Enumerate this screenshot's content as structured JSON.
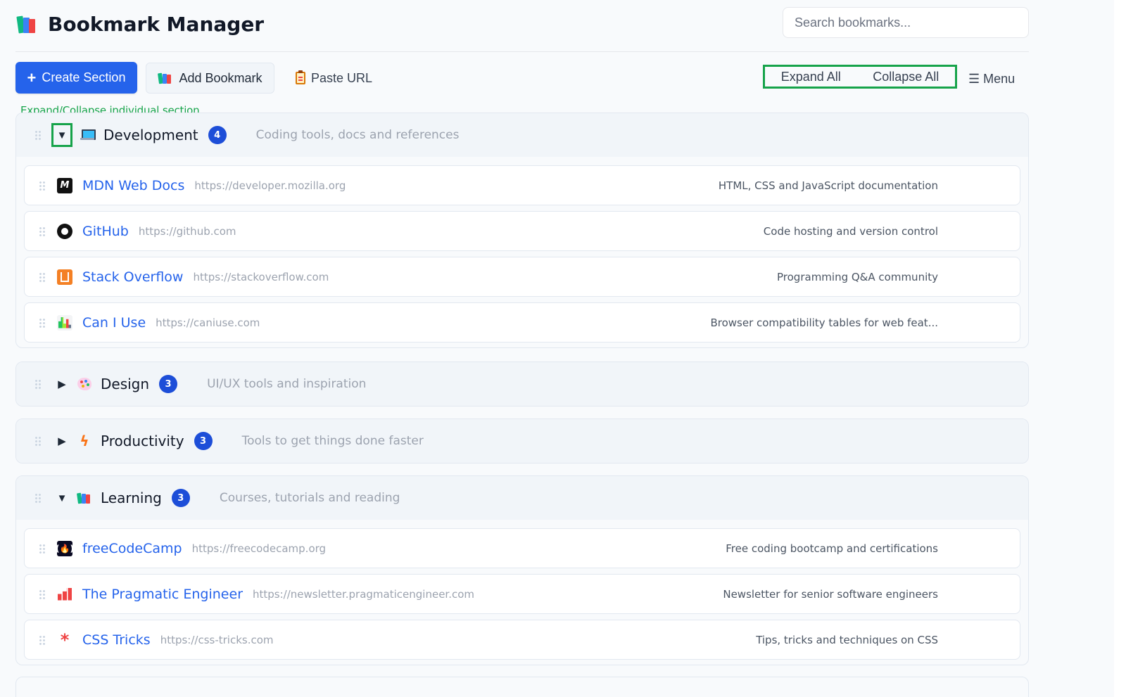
{
  "header": {
    "title": "Bookmark Manager",
    "search_placeholder": "Search bookmarks..."
  },
  "toolbar": {
    "create_section": "Create Section",
    "add_bookmark": "Add Bookmark",
    "paste_url": "Paste URL",
    "expand_all": "Expand All",
    "collapse_all": "Collapse All",
    "menu": "☰ Menu"
  },
  "annotation": "Expand/Collapse individual section",
  "colors": {
    "primary": "#2563eb",
    "highlight": "#16a34a"
  },
  "sections": [
    {
      "name": "Development",
      "count": "4",
      "description": "Coding tools, docs and references",
      "expanded": true,
      "icon": "laptop-icon",
      "bookmarks": [
        {
          "title": "MDN Web Docs",
          "url": "https://developer.mozilla.org",
          "description": "HTML, CSS and JavaScript documentation",
          "icon": "mdn-icon"
        },
        {
          "title": "GitHub",
          "url": "https://github.com",
          "description": "Code hosting and version control",
          "icon": "github-icon"
        },
        {
          "title": "Stack Overflow",
          "url": "https://stackoverflow.com",
          "description": "Programming Q&A community",
          "icon": "stackoverflow-icon"
        },
        {
          "title": "Can I Use",
          "url": "https://caniuse.com",
          "description": "Browser compatibility tables for web feat...",
          "icon": "caniuse-icon"
        }
      ]
    },
    {
      "name": "Design",
      "count": "3",
      "description": "UI/UX tools and inspiration",
      "expanded": false,
      "icon": "palette-icon"
    },
    {
      "name": "Productivity",
      "count": "3",
      "description": "Tools to get things done faster",
      "expanded": false,
      "icon": "lightning-icon"
    },
    {
      "name": "Learning",
      "count": "3",
      "description": "Courses, tutorials and reading",
      "expanded": true,
      "icon": "books-icon",
      "bookmarks": [
        {
          "title": "freeCodeCamp",
          "url": "https://freecodecamp.org",
          "description": "Free coding bootcamp and certifications",
          "icon": "freecodecamp-icon"
        },
        {
          "title": "The Pragmatic Engineer",
          "url": "https://newsletter.pragmaticengineer.com",
          "description": "Newsletter for senior software engineers",
          "icon": "bar-chart-icon"
        },
        {
          "title": "CSS Tricks",
          "url": "https://css-tricks.com",
          "description": "Tips, tricks and techniques on CSS",
          "icon": "asterisk-icon"
        }
      ]
    }
  ]
}
